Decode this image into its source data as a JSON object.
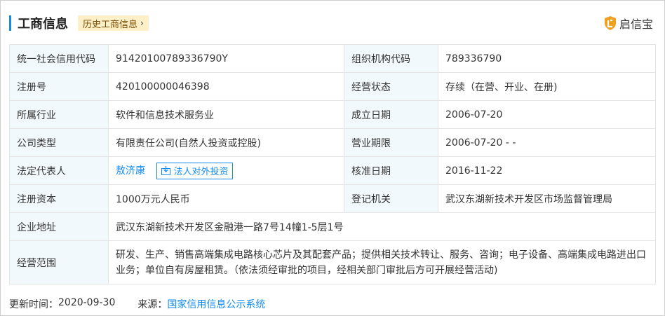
{
  "header": {
    "title": "工商信息",
    "history_button": "历史工商信息",
    "brand": "启信宝"
  },
  "rows": {
    "credit_code_label": "统一社会信用代码",
    "credit_code_value": "91420100789336790Y",
    "org_code_label": "组织机构代码",
    "org_code_value": "789336790",
    "reg_no_label": "注册号",
    "reg_no_value": "420100000046398",
    "status_label": "经营状态",
    "status_value": "存续（在营、开业、在册)",
    "industry_label": "所属行业",
    "industry_value": "软件和信息技术服务业",
    "founded_label": "成立日期",
    "founded_value": "2006-07-20",
    "type_label": "公司类型",
    "type_value": "有限责任公司(自然人投资或控股)",
    "term_label": "营业期限",
    "term_value": "2006-07-20 - -",
    "legal_label": "法定代表人",
    "legal_value": "敖济康",
    "legal_invest_button": "法人对外投资",
    "approved_label": "核准日期",
    "approved_value": "2016-11-22",
    "capital_label": "注册资本",
    "capital_value": "1000万元人民币",
    "authority_label": "登记机关",
    "authority_value": "武汉东湖新技术开发区市场监督管理局",
    "address_label": "企业地址",
    "address_value": "武汉东湖新技术开发区金融港一路7号14幢1-5层1号",
    "scope_label": "经营范围",
    "scope_value": "研发、生产、销售高端集成电路核心芯片及其配套产品；提供相关技术转让、服务、咨询；电子设备、高端集成电路进出口业务；单位自有房屋租赁。（依法须经审批的项目，经相关部门审批后方可开展经营活动)"
  },
  "footer": {
    "updated_label": "更新时间：",
    "updated_value": "2020-09-30",
    "source_label": "来源：",
    "source_link": "国家信用信息公示系统"
  },
  "colors": {
    "accent": "#128bed",
    "label_bg": "#f2f9fc",
    "history_bg": "#fdf0c8",
    "brand_shield": "#f0a020"
  },
  "icons": {
    "brand": "shield-logo-icon",
    "history": "chevron-right-icon",
    "invest": "download-box-icon"
  }
}
